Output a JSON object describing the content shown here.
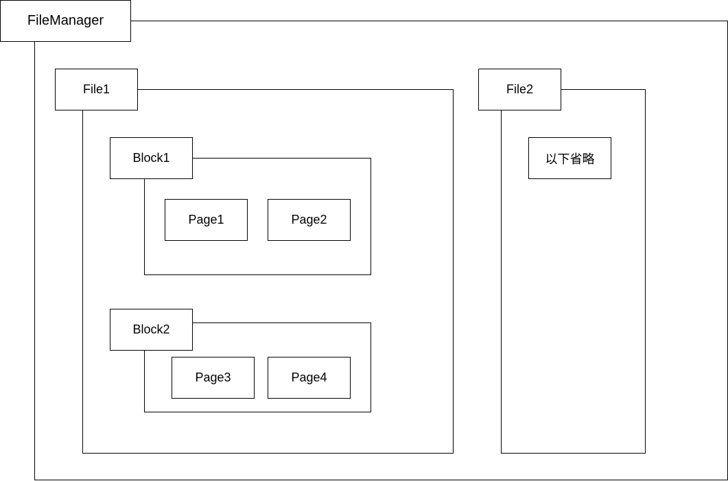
{
  "diagram": {
    "root": {
      "label": "FileManager",
      "files": [
        {
          "label": "File1",
          "blocks": [
            {
              "label": "Block1",
              "pages": [
                "Page1",
                "Page2"
              ]
            },
            {
              "label": "Block2",
              "pages": [
                "Page3",
                "Page4"
              ]
            }
          ]
        },
        {
          "label": "File2",
          "note": "以下省略"
        }
      ]
    }
  }
}
